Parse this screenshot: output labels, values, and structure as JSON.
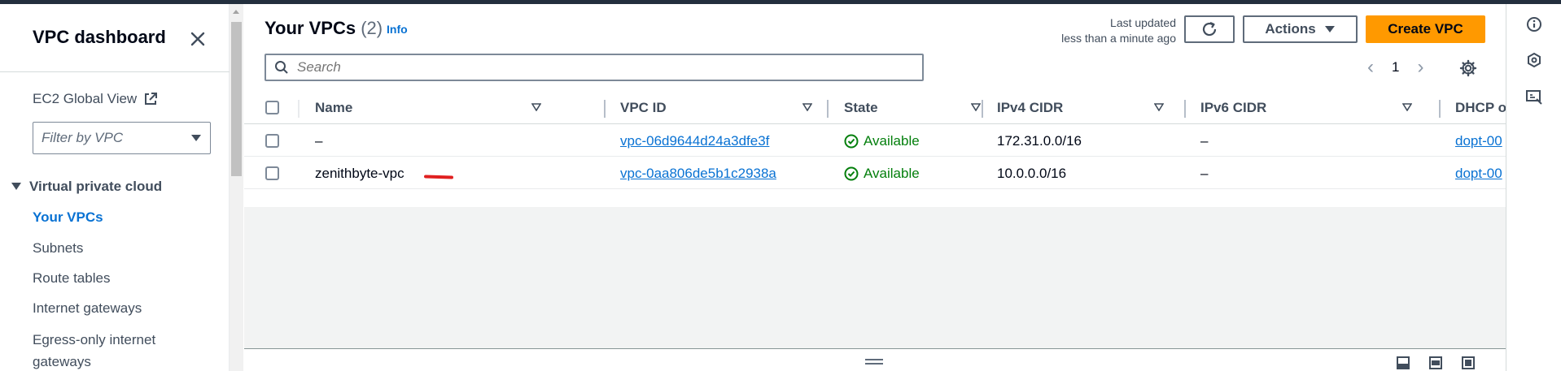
{
  "sidebar": {
    "title": "VPC dashboard",
    "ec2_global_view": "EC2 Global View",
    "filter": {
      "placeholder": "Filter by VPC"
    },
    "section": "Virtual private cloud",
    "items": [
      {
        "label": "Your VPCs",
        "active": true
      },
      {
        "label": "Subnets"
      },
      {
        "label": "Route tables"
      },
      {
        "label": "Internet gateways"
      },
      {
        "label": "Egress-only internet"
      },
      {
        "label": "gateways"
      }
    ]
  },
  "header": {
    "title": "Your VPCs",
    "count": "(2)",
    "info": "Info",
    "last_updated_line1": "Last updated",
    "last_updated_line2": "less than a minute ago",
    "actions_label": "Actions",
    "create_label": "Create VPC"
  },
  "search": {
    "placeholder": "Search"
  },
  "pagination": {
    "current_page": "1"
  },
  "table": {
    "columns": [
      "Name",
      "VPC ID",
      "State",
      "IPv4 CIDR",
      "IPv6 CIDR",
      "DHCP o"
    ],
    "rows": [
      {
        "name": "–",
        "vpc_id": "vpc-06d9644d24a3dfe3f",
        "state": "Available",
        "ipv4": "172.31.0.0/16",
        "ipv6": "–",
        "dhcp": "dopt-00"
      },
      {
        "name": "zenithbyte-vpc",
        "vpc_id": "vpc-0aa806de5b1c2938a",
        "state": "Available",
        "ipv4": "10.0.0.0/16",
        "ipv6": "–",
        "dhcp": "dopt-00"
      }
    ]
  },
  "colors": {
    "accent": "#0972d3",
    "primary_button": "#ff9900",
    "success": "#037f0c",
    "topbar": "#232f3e"
  },
  "icons": {
    "close": "close-icon",
    "external": "external-link-icon",
    "caret": "caret-down-icon",
    "refresh": "refresh-icon",
    "search": "search-icon",
    "settings": "gear-icon",
    "available": "check-circle-icon",
    "rail": [
      "info-icon",
      "hexagon-icon",
      "feedback-icon"
    ]
  }
}
